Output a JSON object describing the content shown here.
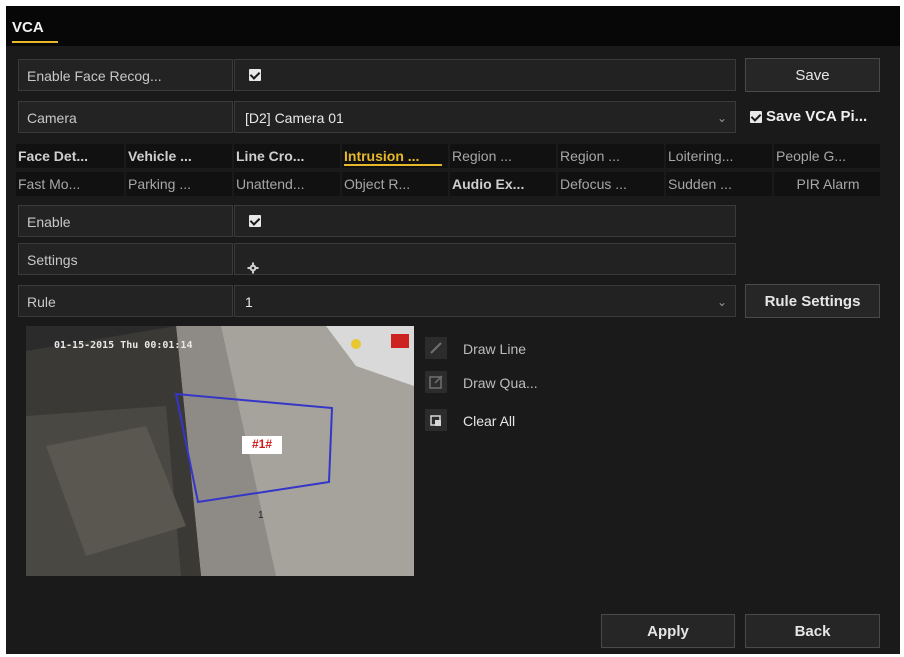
{
  "title": "VCA",
  "face_recog": {
    "label": "Enable Face Recog...",
    "checked": true
  },
  "save_button": "Save",
  "camera": {
    "label": "Camera",
    "value": "[D2] Camera 01"
  },
  "save_vca_pic": {
    "label": "Save VCA Pi...",
    "checked": true
  },
  "tabs_row1": [
    "Face Det...",
    "Vehicle ...",
    "Line Cro...",
    "Intrusion ...",
    "Region ...",
    "Region ...",
    "Loitering...",
    "People G..."
  ],
  "tabs_row2": [
    "Fast Mo...",
    "Parking ...",
    "Unattend...",
    "Object R...",
    "Audio Ex...",
    "Defocus ...",
    "Sudden ...",
    "PIR Alarm"
  ],
  "active_tab": "Intrusion ...",
  "enable": {
    "label": "Enable",
    "checked": true
  },
  "settings": {
    "label": "Settings",
    "icon": "gear-icon"
  },
  "rule": {
    "label": "Rule",
    "value": "1"
  },
  "rule_settings_button": "Rule Settings",
  "preview": {
    "timestamp": "01-15-2015 Thu 00:01:14",
    "region_label": "#1#",
    "marker": "1"
  },
  "tools": {
    "draw_line": "Draw Line",
    "draw_quad": "Draw Qua...",
    "clear_all": "Clear All"
  },
  "apply_button": "Apply",
  "back_button": "Back",
  "colors": {
    "accent": "#e8b82b",
    "region": "#3535c8",
    "label_bg": "#ffffff",
    "label_fg": "#d01818"
  }
}
